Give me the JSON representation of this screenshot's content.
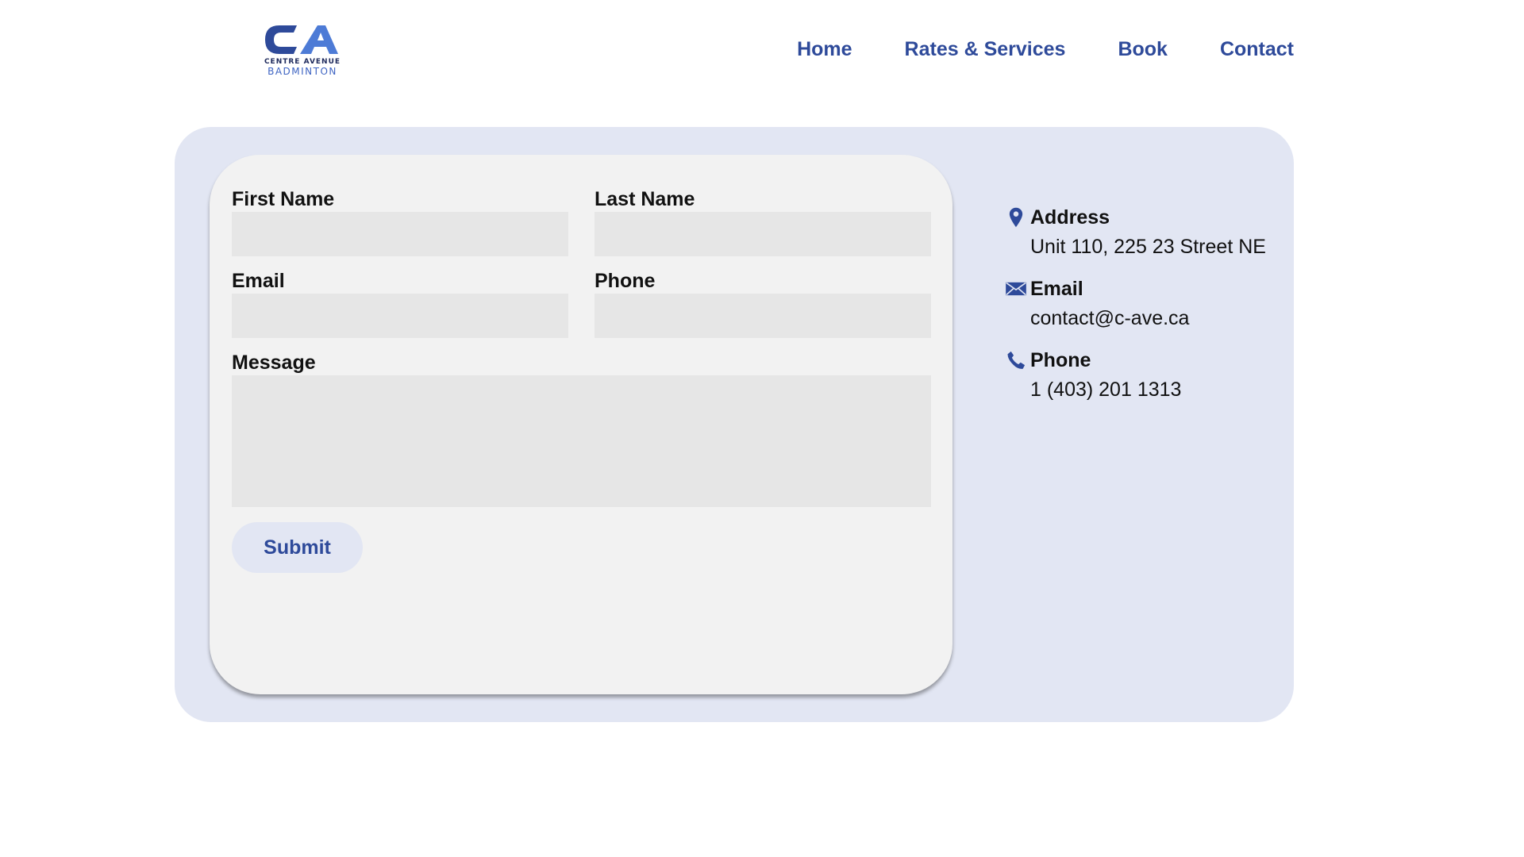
{
  "brand": {
    "logo_line1": "CENTRE AVENUE",
    "logo_line2": "BADMINTON",
    "primary_color": "#2e4a9a",
    "accent_color": "#3d63c2"
  },
  "nav": {
    "items": [
      "Home",
      "Rates & Services",
      "Book",
      "Contact"
    ]
  },
  "form": {
    "first_name_label": "First Name",
    "first_name_value": "",
    "last_name_label": "Last Name",
    "last_name_value": "",
    "email_label": "Email",
    "email_value": "",
    "phone_label": "Phone",
    "phone_value": "",
    "message_label": "Message",
    "message_value": "",
    "submit_label": "Submit"
  },
  "contact": {
    "address_heading": "Address",
    "address_value": "Unit 110, 225 23 Street NE",
    "address_icon": "map-pin-icon",
    "email_heading": "Email",
    "email_value": "contact@c-ave.ca",
    "email_icon": "envelope-icon",
    "phone_heading": "Phone",
    "phone_value": "1 (403) 201 1313",
    "phone_icon": "phone-icon"
  }
}
